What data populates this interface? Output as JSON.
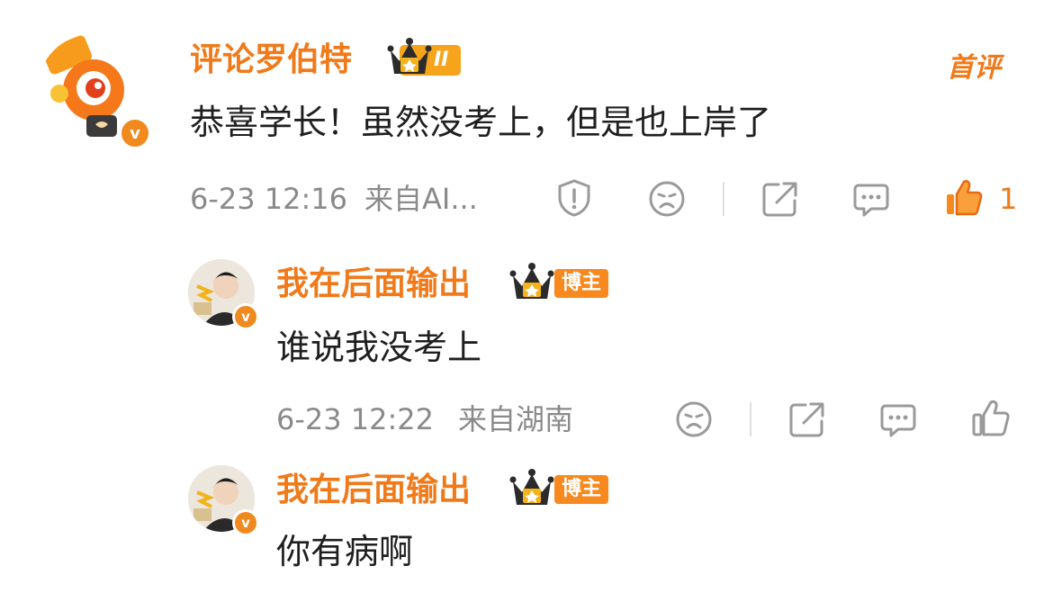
{
  "comment": {
    "author": "评论罗伯特",
    "level": "II",
    "tag": "首评",
    "text": "恭喜学长！虽然没考上，但是也上岸了",
    "time": "6-23 12:16",
    "source": "来自AI...",
    "like_count": "1"
  },
  "replies": [
    {
      "author": "我在后面输出",
      "badge": "博主",
      "text": "谁说我没考上",
      "time": "6-23 12:22",
      "source": "来自湖南"
    },
    {
      "author": "我在后面输出",
      "badge": "博主",
      "text": "你有病啊"
    }
  ],
  "colors": {
    "accent": "#f07a1a",
    "meta": "#8a8a8a",
    "icon": "#9a9a9a",
    "like_active": "#f07a1a"
  },
  "icons": [
    "report-icon",
    "dislike-face-icon",
    "share-icon",
    "comment-icon",
    "like-icon",
    "verified-v-icon",
    "crown-icon"
  ]
}
